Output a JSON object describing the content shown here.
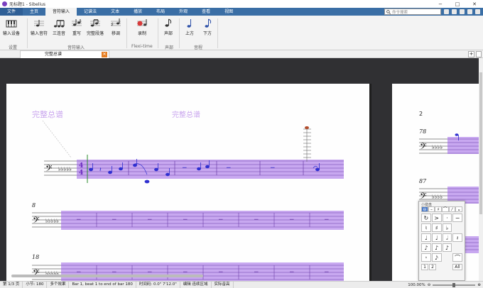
{
  "window": {
    "title": "无标题1 - Sibelius",
    "minimize": "−",
    "restore": "□",
    "close": "✕"
  },
  "tabs": [
    "文件",
    "主页",
    "音符输入",
    "记谱法",
    "文本",
    "播放",
    "布局",
    "外观",
    "查看",
    "视图"
  ],
  "search": {
    "placeholder": "命令搜索"
  },
  "ribbon": {
    "buttons": [
      {
        "label": "输入设备"
      },
      {
        "label": "输入音符"
      },
      {
        "label": "三连音"
      },
      {
        "label": "重写"
      },
      {
        "label": "完整段落"
      },
      {
        "label": "移调"
      },
      {
        "label": "录制"
      },
      {
        "label": "声部"
      },
      {
        "label": "上方"
      },
      {
        "label": "下方"
      }
    ],
    "groups": [
      "设置",
      "音符输入",
      "Flexi-time",
      "声部",
      "音程"
    ]
  },
  "document_tab": {
    "label": "完整总谱"
  },
  "score": {
    "page1": {
      "title_left": "完整总谱",
      "title_center": "完整总谱",
      "bar_numbers": [
        "8",
        "18"
      ],
      "time_sig_top": "4",
      "time_sig_bottom": "4"
    },
    "page2": {
      "page_number": "2",
      "bar_numbers": [
        "78",
        "87"
      ]
    }
  },
  "keypad": {
    "title": "小键盘",
    "top_tabs": [
      "⊖",
      "–",
      "♯",
      "⌒",
      "⁄",
      "𝄪"
    ],
    "rows": [
      [
        "↻",
        ">",
        "·",
        "−"
      ],
      [
        "♮",
        "♯",
        "♭",
        ""
      ],
      [
        "♩",
        "♩",
        "𝅗𝅥",
        "𝄽"
      ],
      [
        "♪",
        "♪",
        "♪",
        ""
      ],
      [
        "𝄾",
        "𝅘𝅥𝅯",
        "",
        "⌒"
      ]
    ],
    "bottom": [
      "1",
      "2",
      "All"
    ]
  },
  "status": {
    "page": "第 1/3 页",
    "bar": "小节: 180",
    "selection": "多个效果",
    "range": "Bar 1, beat 1 to end of bar 180",
    "time": "时间码: 0.0\" 7'12.0\"",
    "edit": "编辑 连续区域",
    "pitch": "实际音高",
    "zoom": "100.00%"
  },
  "colors": {
    "ribbon_tab_bg": "#3a6ea5",
    "selection_purple": "#c8a8f0",
    "note_blue": "#2f2fd0"
  }
}
